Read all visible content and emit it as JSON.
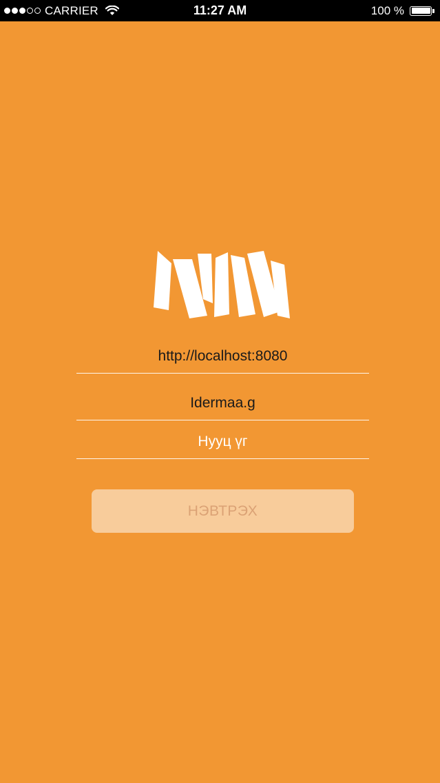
{
  "status_bar": {
    "carrier": "CARRIER",
    "time": "11:27 AM",
    "battery_percent": "100 %",
    "signal_strength_of_5": 3,
    "battery_level": 1.0
  },
  "logo": {
    "text": "NM",
    "color": "#ffffff"
  },
  "form": {
    "server_url": {
      "value": "http://localhost:8080"
    },
    "username": {
      "value": "Idermaa.g"
    },
    "password": {
      "placeholder": "Нууц үг",
      "value": ""
    },
    "login_label": "НЭВТРЭХ"
  },
  "colors": {
    "background": "#f29733",
    "button_background": "#f8cc9b",
    "button_text": "#dba275",
    "field_text": "#1a1a1a",
    "placeholder_text": "#ffffff"
  }
}
